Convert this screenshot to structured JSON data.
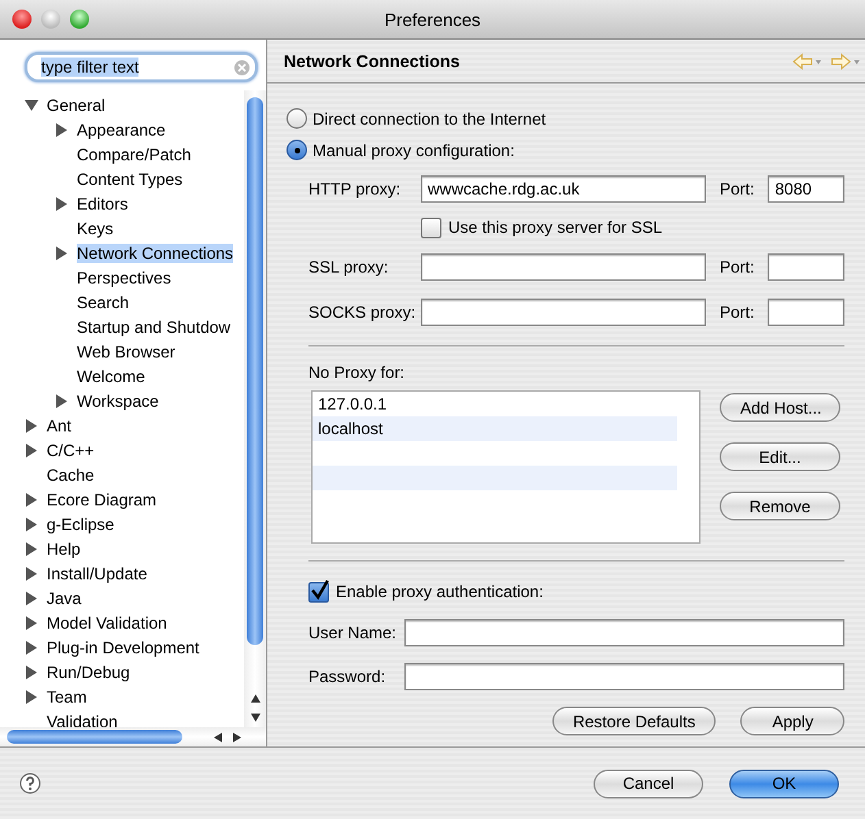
{
  "window": {
    "title": "Preferences"
  },
  "filter": {
    "value": "type filter text"
  },
  "tree": [
    {
      "label": "General",
      "expanded": true,
      "selected": false,
      "children": [
        {
          "label": "Appearance",
          "expanded": false,
          "selected": false
        },
        {
          "label": "Compare/Patch",
          "selected": false
        },
        {
          "label": "Content Types",
          "selected": false
        },
        {
          "label": "Editors",
          "expanded": false,
          "selected": false
        },
        {
          "label": "Keys",
          "selected": false
        },
        {
          "label": "Network Connections",
          "expanded": false,
          "selected": true
        },
        {
          "label": "Perspectives",
          "selected": false
        },
        {
          "label": "Search",
          "selected": false
        },
        {
          "label": "Startup and Shutdow",
          "selected": false
        },
        {
          "label": "Web Browser",
          "selected": false
        },
        {
          "label": "Welcome",
          "selected": false
        },
        {
          "label": "Workspace",
          "expanded": false,
          "selected": false
        }
      ]
    },
    {
      "label": "Ant",
      "expanded": false,
      "selected": false
    },
    {
      "label": "C/C++",
      "expanded": false,
      "selected": false
    },
    {
      "label": "Cache",
      "selected": false
    },
    {
      "label": "Ecore Diagram",
      "expanded": false,
      "selected": false
    },
    {
      "label": "g-Eclipse",
      "expanded": false,
      "selected": false
    },
    {
      "label": "Help",
      "expanded": false,
      "selected": false
    },
    {
      "label": "Install/Update",
      "expanded": false,
      "selected": false
    },
    {
      "label": "Java",
      "expanded": false,
      "selected": false
    },
    {
      "label": "Model Validation",
      "expanded": false,
      "selected": false
    },
    {
      "label": "Plug-in Development",
      "expanded": false,
      "selected": false
    },
    {
      "label": "Run/Debug",
      "expanded": false,
      "selected": false
    },
    {
      "label": "Team",
      "expanded": false,
      "selected": false
    },
    {
      "label": "Validation",
      "selected": false
    }
  ],
  "page": {
    "title": "Network Connections",
    "proxy_modes": [
      {
        "label": "Direct connection to the Internet",
        "selected": false
      },
      {
        "label": "Manual proxy configuration:",
        "selected": true
      }
    ],
    "proxies": [
      {
        "kind": "field",
        "label": "HTTP proxy:",
        "value": "wwwcache.rdg.ac.uk",
        "port_label": "Port:",
        "port_value": "8080"
      },
      {
        "kind": "checkbox",
        "label": "Use this proxy server for SSL",
        "checked": false
      },
      {
        "kind": "field",
        "label": "SSL proxy:",
        "port_label": "Port:"
      },
      {
        "kind": "field",
        "label": "SOCKS proxy:",
        "port_label": "Port:"
      }
    ],
    "no_proxy": {
      "label": "No Proxy for:",
      "hosts": [
        "127.0.0.1",
        "localhost"
      ],
      "buttons": [
        "Add Host...",
        "Edit...",
        "Remove"
      ]
    },
    "auth": {
      "label": "Enable proxy authentication:",
      "checked": true
    },
    "credentials": [
      {
        "label": "User Name:"
      },
      {
        "label": "Password:"
      }
    ],
    "buttons": [
      "Restore Defaults",
      "Apply"
    ]
  },
  "dialog_buttons": [
    {
      "label": "Cancel",
      "default": false
    },
    {
      "label": "OK",
      "default": true
    }
  ]
}
